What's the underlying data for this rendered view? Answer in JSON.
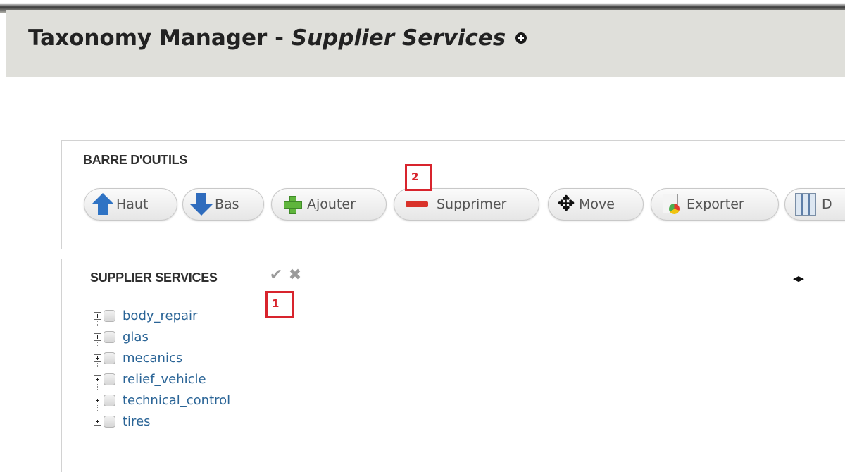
{
  "page": {
    "title_main": "Taxonomy Manager - ",
    "title_vocab": "Supplier Services"
  },
  "toolbar": {
    "heading": "BARRE D'OUTILS",
    "buttons": [
      {
        "label": "Haut",
        "icon": "arrow-up-icon"
      },
      {
        "label": "Bas",
        "icon": "arrow-down-icon"
      },
      {
        "label": "Ajouter",
        "icon": "plus-icon"
      },
      {
        "label": "Supprimer",
        "icon": "minus-icon"
      },
      {
        "label": "Move",
        "icon": "move-icon"
      },
      {
        "label": "Exporter",
        "icon": "export-icon"
      },
      {
        "label": "D",
        "icon": "columns-icon"
      }
    ]
  },
  "annotations": {
    "one": "1",
    "two": "2",
    "color": "#d8242d"
  },
  "tree": {
    "heading": "SUPPLIER SERVICES",
    "items": [
      "body_repair",
      "glas",
      "mecanics",
      "relief_vehicle",
      "technical_control",
      "tires"
    ]
  },
  "colors": {
    "link": "#2a6496",
    "title_bar": "#dfdfda"
  }
}
